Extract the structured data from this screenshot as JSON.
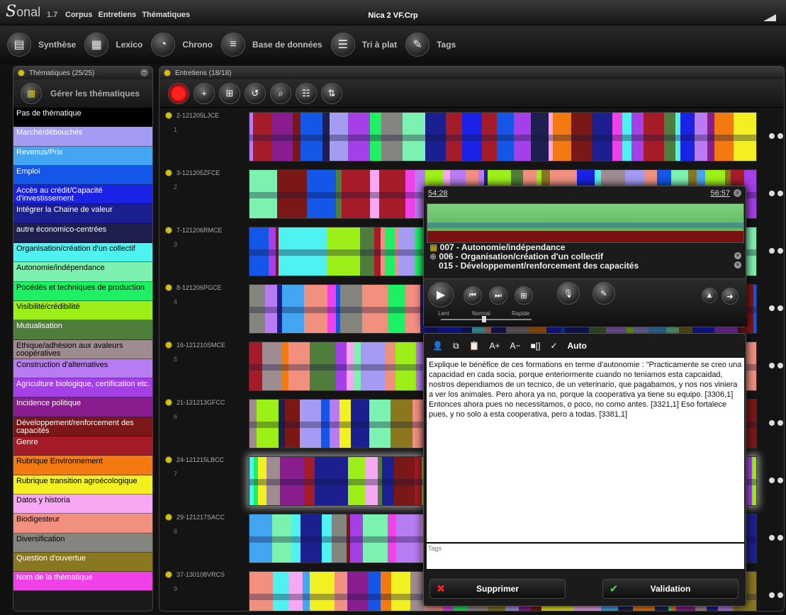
{
  "app": {
    "logo_letter": "S",
    "logo_rest": "onal",
    "version": "1.7",
    "window_title": "Nica 2 VF.Crp"
  },
  "menu": [
    "Corpus",
    "Entretiens",
    "Thématiques"
  ],
  "toolbar": [
    {
      "label": "Synthèse",
      "icon": "▤"
    },
    {
      "label": "Lexico",
      "icon": "▦"
    },
    {
      "label": "Chrono",
      "icon": "◔"
    },
    {
      "label": "Base de données",
      "icon": "≡"
    },
    {
      "label": "Tri à plat",
      "icon": "☰"
    },
    {
      "label": "Tags",
      "icon": "✎"
    }
  ],
  "themes_panel": {
    "header": "Thématiques (25/25)",
    "manage_label": "Gérer les thématiques",
    "items": [
      {
        "label": "Pas de thématique",
        "bg": "#000000",
        "fg": "#ffffff"
      },
      {
        "label": "Marché/débouchés",
        "bg": "#a49bf2",
        "fg": "#ffffff"
      },
      {
        "label": "Revenus/Prix",
        "bg": "#43a6f2",
        "fg": "#ffffff"
      },
      {
        "label": "Emploi",
        "bg": "#1356e8",
        "fg": "#ffffff"
      },
      {
        "label": "Accès au crédit/Capacité d'investissement",
        "bg": "#1a22e6",
        "fg": "#ffffff"
      },
      {
        "label": "Intégrer la Chaine de valeur",
        "bg": "#1b1f8f",
        "fg": "#ffffff"
      },
      {
        "label": "autre économico-centrées",
        "bg": "#1d1f4f",
        "fg": "#ffffff"
      },
      {
        "label": "Organisation/création d'un collectif",
        "bg": "#4ef2f0",
        "fg": "#000000"
      },
      {
        "label": "Autonomie/indépendance",
        "bg": "#7cf2b0",
        "fg": "#000000"
      },
      {
        "label": "Pocédés et techniques de production",
        "bg": "#1ef063",
        "fg": "#000000"
      },
      {
        "label": "Visibilité/crédibilité",
        "bg": "#9cf018",
        "fg": "#000000"
      },
      {
        "label": "Mutualisation",
        "bg": "#4f7d3b",
        "fg": "#ffffff"
      },
      {
        "label": "Ethique/adhésion aux avaleurs coopératives",
        "bg": "#9e8c90",
        "fg": "#000000"
      },
      {
        "label": "Construction d'alternatives",
        "bg": "#b87cf2",
        "fg": "#000000"
      },
      {
        "label": "Agriculture biologique, certification etc.",
        "bg": "#a53fe8",
        "fg": "#ffffff"
      },
      {
        "label": "Incidence politique",
        "bg": "#891c8e",
        "fg": "#ffffff"
      },
      {
        "label": "Développement/renforcement des capacités",
        "bg": "#7a1717",
        "fg": "#ffffff"
      },
      {
        "label": "Genre",
        "bg": "#a51b28",
        "fg": "#ffffff"
      },
      {
        "label": "Rubrique Environnement",
        "bg": "#f27a10",
        "fg": "#000000"
      },
      {
        "label": "Rubrique transition agroécologique",
        "bg": "#f2f020",
        "fg": "#000000"
      },
      {
        "label": "Datos y historia",
        "bg": "#f7a8f2",
        "fg": "#000000"
      },
      {
        "label": "Biodigesteur",
        "bg": "#f29080",
        "fg": "#000000"
      },
      {
        "label": "Diversification",
        "bg": "#858580",
        "fg": "#000000"
      },
      {
        "label": "Question d'ouvertue",
        "bg": "#8a7820",
        "fg": "#ffffff"
      },
      {
        "label": "Nom de la thématique",
        "bg": "#f040e8",
        "fg": "#ffffff"
      }
    ]
  },
  "interviews_panel": {
    "header": "Entretiens (18/18)",
    "actions": [
      "record-button",
      "add-interview-button",
      "import-button",
      "refresh-button",
      "search-button",
      "layout-button",
      "sort-button"
    ],
    "rows": [
      {
        "name": "2-121205LJCE",
        "num": "1"
      },
      {
        "name": "3-121205ZFCE",
        "num": "2"
      },
      {
        "name": "7-121206RMCE",
        "num": "3"
      },
      {
        "name": "8-121206PGCE",
        "num": "4"
      },
      {
        "name": "16-121210SMCE",
        "num": "5"
      },
      {
        "name": "21-121213GFCC",
        "num": "6"
      },
      {
        "name": "24-121215LBCC",
        "num": "7"
      },
      {
        "name": "29-121217SACC",
        "num": "8"
      },
      {
        "name": "37-130108VRCS",
        "num": "9"
      }
    ]
  },
  "player": {
    "time_start": "54:28",
    "time_end": "56:57",
    "themes": [
      "007 - Autonomie/indépendance",
      "006 - Organisation/création d'un collectif",
      "015 - Développement/renforcement des capacités"
    ],
    "speed_labels": [
      "Lent",
      "Normal",
      "Rapide"
    ]
  },
  "editor": {
    "auto_label": "Auto",
    "text": "Explique le bénéfice de ces formations  en terme d'autonomie : \"Practicamente se creo una capacidad en cada socia, porque enteriormente cuando no teniamos esta capcaidad, nostros dependiamos de un tecnico, de un veterinario, que pagabamos, y nos nos viniera a ver los animales. Pero ahora ya no, porque la cooperativa ya tiene su equipo. [3306,1] Entonces ahora pues no necessitamos, o poco, no como antes. [3321,1] Eso fortalece pues, y no solo a esta cooperativa, pero a todas. [3381,1]",
    "tags_label": "Tags",
    "delete_label": "Supprimer",
    "validate_label": "Validation"
  }
}
